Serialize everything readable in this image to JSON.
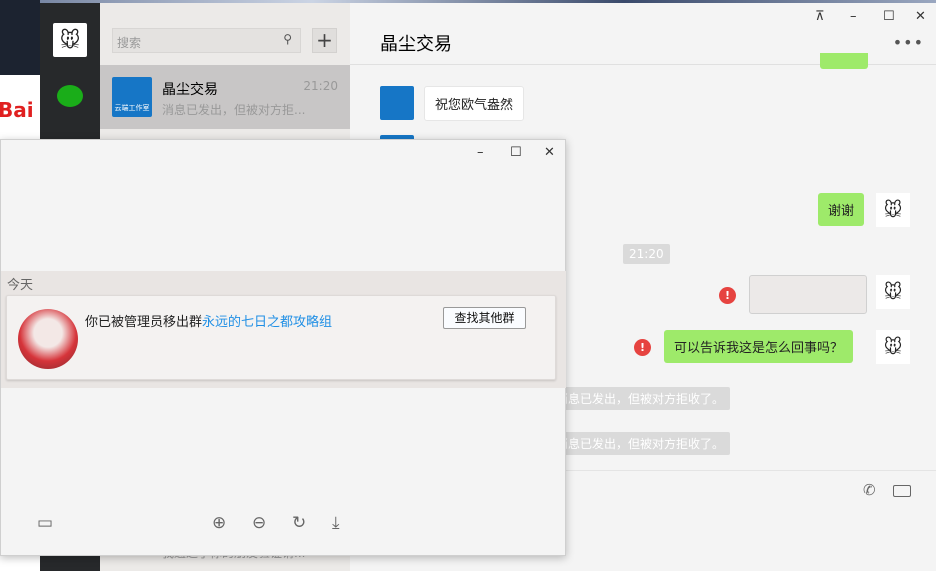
{
  "contacts_list": {
    "search_placeholder": "搜索",
    "add_button": "+",
    "items": [
      {
        "name": "晶尘交易",
        "time": "21:20",
        "preview": "消息已发出，但被对方拒...",
        "logo_text": "云端工作室"
      },
      {
        "preview": "我通过了你的朋友验证请..."
      }
    ]
  },
  "chat": {
    "title": "晶尘交易",
    "more": "•••",
    "window_controls": {
      "pin": "⊼",
      "minimize": "–",
      "maximize": "☐",
      "close": "✕"
    },
    "messages": [
      {
        "from": "other",
        "text": "祝您欧气盎然"
      },
      {
        "from": "me",
        "text": "谢谢"
      },
      {
        "type": "time",
        "text": "21:20"
      },
      {
        "from": "me",
        "type": "image",
        "status": "failed"
      },
      {
        "from": "me",
        "text": "可以告诉我这是怎么回事吗？",
        "status": "failed"
      },
      {
        "type": "system",
        "text": "消息已发出，但被对方拒收了。"
      },
      {
        "type": "system",
        "text": "消息已发出，但被对方拒收了。"
      }
    ]
  },
  "popup": {
    "window_controls": {
      "minimize": "–",
      "maximize": "☐",
      "close": "✕"
    },
    "date_label": "今天",
    "notice_prefix": "你已被管理员移出群",
    "group_name": "永远的七日之都攻略组",
    "find_button": "查找其他群",
    "toolbar": [
      "thumbnails",
      "zoom-in",
      "zoom-out",
      "rotate",
      "download"
    ]
  },
  "colors": {
    "accent_green": "#9eea6a",
    "nav_dark": "#27292b",
    "link_blue": "#1f8fe5",
    "error_red": "#e64340"
  }
}
